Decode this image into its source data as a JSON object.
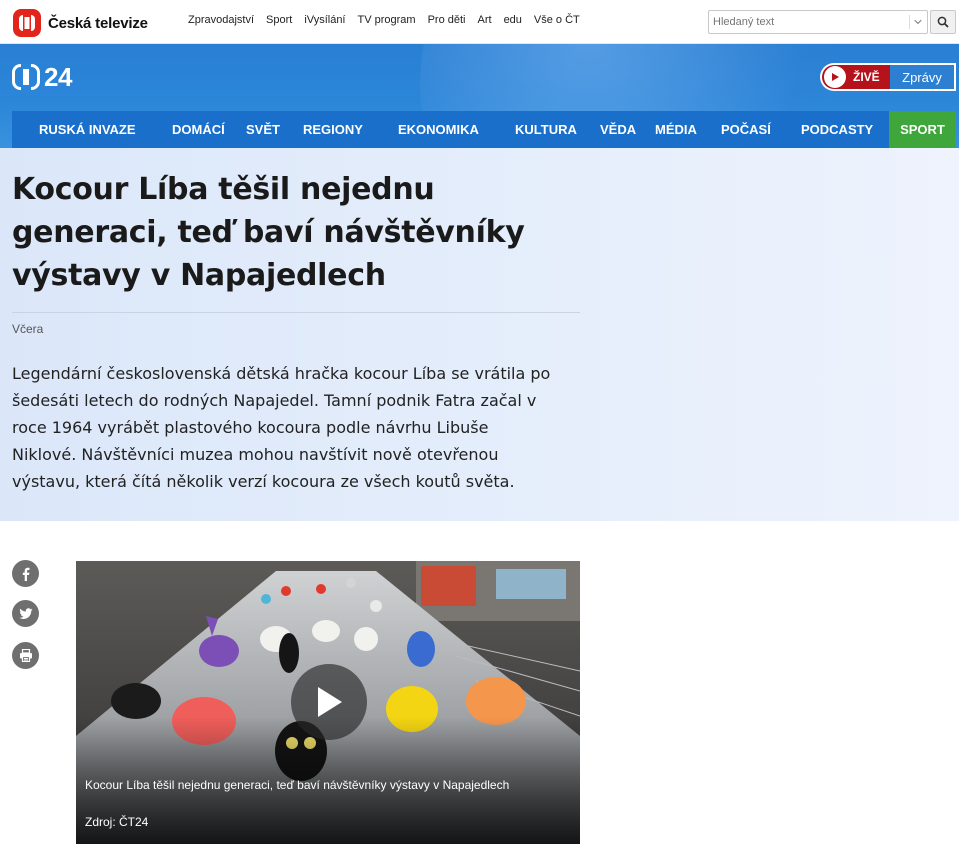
{
  "topbar": {
    "brand": "Česká televize",
    "nav": [
      "Zpravodajství",
      "Sport",
      "iVysílání",
      "TV program",
      "Pro děti",
      "Art",
      "edu",
      "Vše o ČT"
    ],
    "search_placeholder": "Hledaný text"
  },
  "header": {
    "logo_text": "24",
    "live_label": "ŽIVĚ",
    "news_label": "Zprávy",
    "nav": [
      {
        "label": "RUSKÁ INVAZE"
      },
      {
        "label": "DOMÁCÍ"
      },
      {
        "label": "SVĚT"
      },
      {
        "label": "REGIONY"
      },
      {
        "label": "EKONOMIKA"
      },
      {
        "label": "KULTURA"
      },
      {
        "label": "VĚDA"
      },
      {
        "label": "MÉDIA"
      },
      {
        "label": "POČASÍ"
      },
      {
        "label": "PODCASTY"
      },
      {
        "label": "SPORT"
      }
    ]
  },
  "article": {
    "title": "Kocour Líba těšil nejednu generaci, teď baví návštěvníky výstavy v Napajedlech",
    "date": "Včera",
    "perex": "Legendární československá dětská hračka kocour Líba se vrátila po šedesáti letech do rodných Napajedel. Tamní podnik Fatra začal v roce 1964 vyrábět plastového kocoura podle návrhu Libuše Niklové. Návštěvníci muzea mohou navštívit nově otevřenou výstavu, která čítá několik verzí kocoura ze všech koutů světa."
  },
  "video": {
    "caption": "Kocour Líba těšil nejednu generaci, teď baví návštěvníky výstavy v Napajedlech",
    "source": "Zdroj: ČT24"
  },
  "colors": {
    "brand_red": "#e2241a",
    "header_blue": "#2b86d9",
    "nav_blue": "#1a6fcb",
    "sport_green": "#3ea63a",
    "live_red": "#b5121b"
  }
}
